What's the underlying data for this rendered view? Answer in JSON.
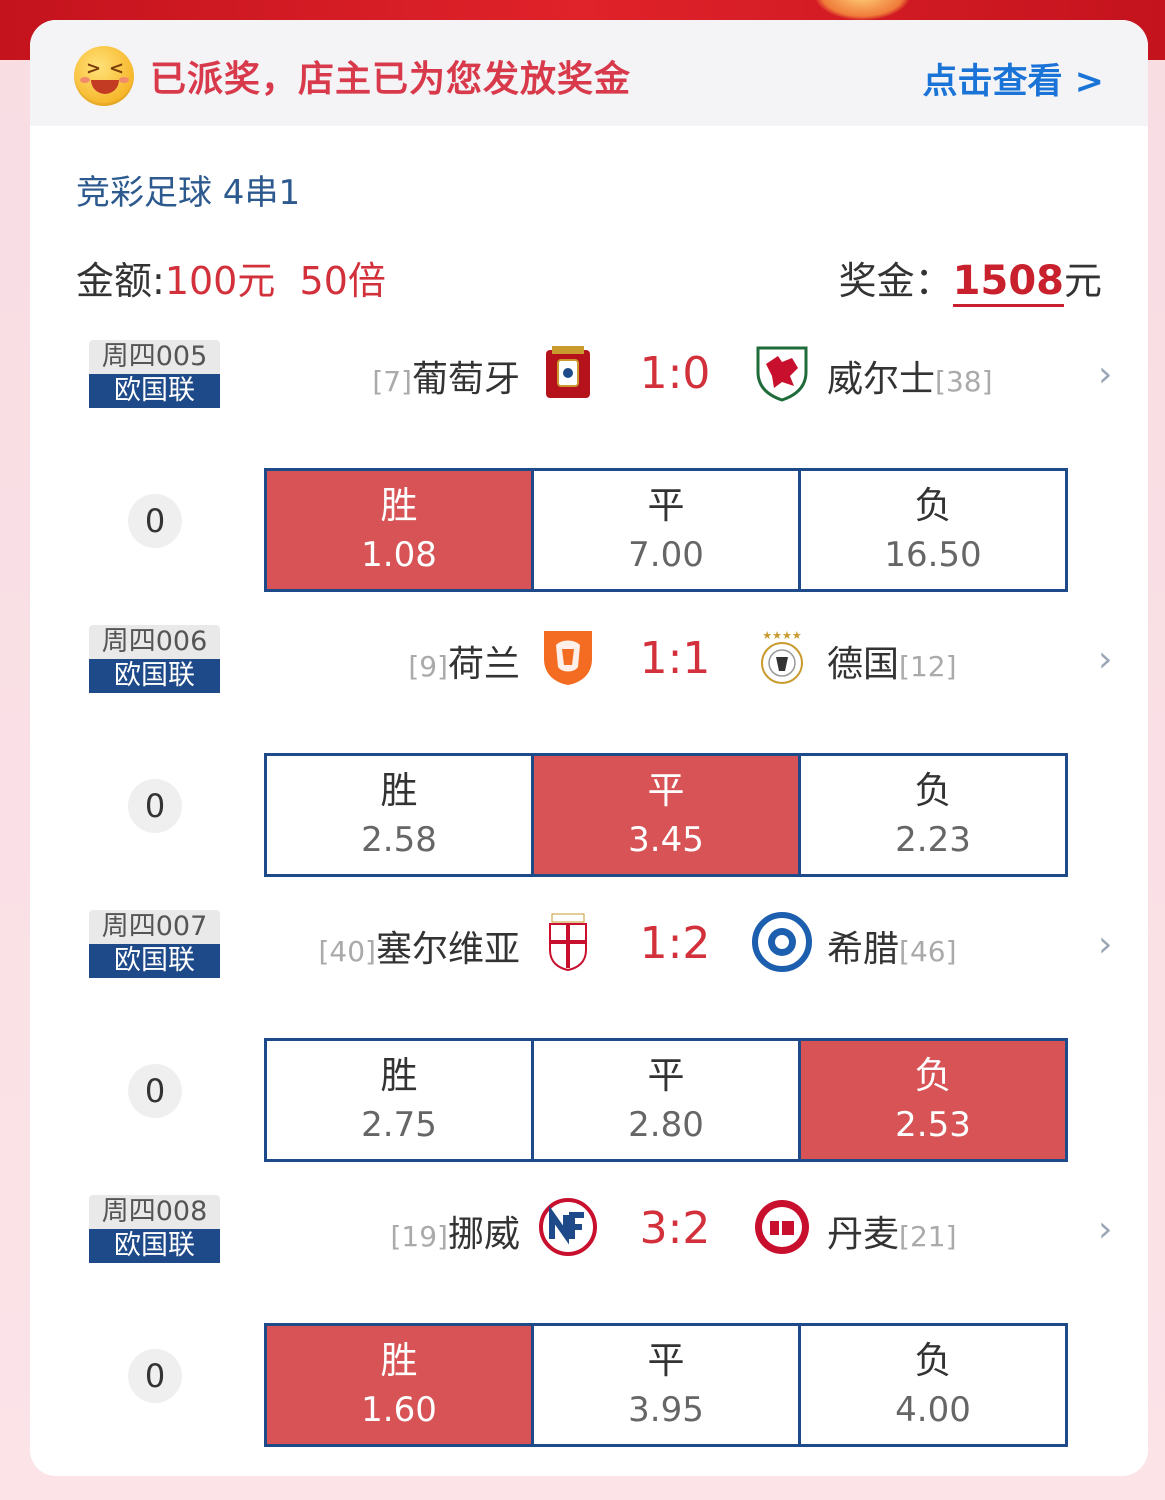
{
  "banner": {
    "text": "已派奖，店主已为您发放奖金",
    "link": "点击查看 >"
  },
  "bet": {
    "type": "竞彩足球 4串1",
    "amount_label": "金额:",
    "amount_value": "100元",
    "multiplier": "50倍",
    "prize_label": "奖金：",
    "prize_value": "1508",
    "prize_unit": "元"
  },
  "matches": [
    {
      "week": "周四005",
      "league": "欧国联",
      "home_rank": "[7]",
      "home": "葡萄牙",
      "score": "1:0",
      "away": "威尔士",
      "away_rank": "[38]",
      "count": "0",
      "odds": [
        {
          "label": "胜",
          "value": "1.08",
          "selected": true
        },
        {
          "label": "平",
          "value": "7.00",
          "selected": false
        },
        {
          "label": "负",
          "value": "16.50",
          "selected": false
        }
      ]
    },
    {
      "week": "周四006",
      "league": "欧国联",
      "home_rank": "[9]",
      "home": "荷兰",
      "score": "1:1",
      "away": "德国",
      "away_rank": "[12]",
      "count": "0",
      "odds": [
        {
          "label": "胜",
          "value": "2.58",
          "selected": false
        },
        {
          "label": "平",
          "value": "3.45",
          "selected": true
        },
        {
          "label": "负",
          "value": "2.23",
          "selected": false
        }
      ]
    },
    {
      "week": "周四007",
      "league": "欧国联",
      "home_rank": "[40]",
      "home": "塞尔维亚",
      "score": "1:2",
      "away": "希腊",
      "away_rank": "[46]",
      "count": "0",
      "odds": [
        {
          "label": "胜",
          "value": "2.75",
          "selected": false
        },
        {
          "label": "平",
          "value": "2.80",
          "selected": false
        },
        {
          "label": "负",
          "value": "2.53",
          "selected": true
        }
      ]
    },
    {
      "week": "周四008",
      "league": "欧国联",
      "home_rank": "[19]",
      "home": "挪威",
      "score": "3:2",
      "away": "丹麦",
      "away_rank": "[21]",
      "count": "0",
      "odds": [
        {
          "label": "胜",
          "value": "1.60",
          "selected": true
        },
        {
          "label": "平",
          "value": "3.95",
          "selected": false
        },
        {
          "label": "负",
          "value": "4.00",
          "selected": false
        }
      ]
    }
  ],
  "colors": {
    "selected": "#d75355",
    "accent_red": "#d2303a",
    "navy": "#1e4a8a",
    "link_blue": "#1a73d6"
  },
  "icons": {
    "crests": [
      "portugal-crest-icon",
      "wales-crest-icon",
      "netherlands-crest-icon",
      "germany-crest-icon",
      "serbia-crest-icon",
      "greece-crest-icon",
      "norway-crest-icon",
      "denmark-crest-icon"
    ],
    "row_chevron": "chevron-right-icon",
    "banner_emoji": "grinning-emoji-icon"
  }
}
